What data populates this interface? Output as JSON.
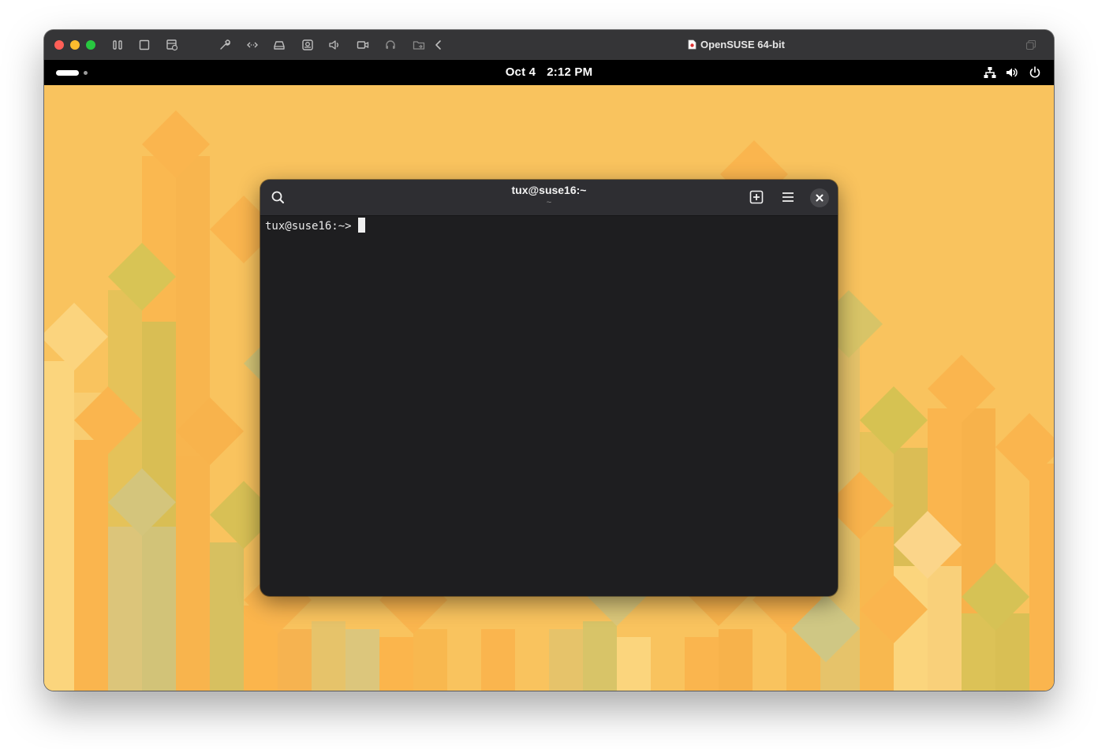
{
  "host_window": {
    "title": "OpenSUSE 64-bit",
    "toolbar_icons": [
      "sidebar-toggle-icon",
      "display-icon",
      "snapshot-icon",
      "settings-wrench-icon",
      "network-icon",
      "hard-disk-icon",
      "camera-icon",
      "sound-icon",
      "video-icon",
      "headphones-icon",
      "shared-folder-icon",
      "back-chevron-icon"
    ],
    "colors": {
      "close": "#ff5f57",
      "minimize": "#febc2e",
      "maximize": "#28c840",
      "toolbar": "#353537"
    }
  },
  "gnome_bar": {
    "date": "Oct 4",
    "time": "2:12 PM",
    "status_icons": [
      "network-wired-icon",
      "volume-icon",
      "power-icon"
    ]
  },
  "terminal": {
    "title": "tux@suse16:~",
    "subtitle": "~",
    "prompt": "tux@suse16:~>",
    "header_icons": [
      "search-icon",
      "new-tab-icon",
      "hamburger-menu-icon",
      "close-icon"
    ],
    "colors": {
      "background": "#1e1e20",
      "header": "#2e2e32",
      "text": "#e8e8e8"
    }
  },
  "wallpaper": {
    "base_color": "#f9c35e"
  }
}
